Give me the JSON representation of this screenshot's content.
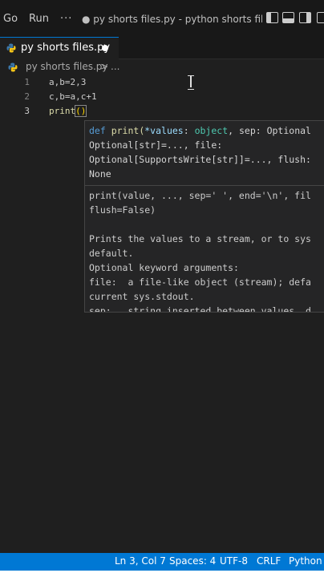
{
  "menu": {
    "go": "Go",
    "run": "Run",
    "more": "···"
  },
  "window_title": "● py shorts files.py - python shorts files - ...",
  "tab": {
    "label": "py shorts files.py",
    "modified": true
  },
  "breadcrumb": {
    "file": "py shorts files.py",
    "chevron": ">",
    "more": "..."
  },
  "editor": {
    "lines": [
      {
        "number": "1",
        "code": "a,b=2,3"
      },
      {
        "number": "2",
        "code": "c,b=a,c+1"
      },
      {
        "number": "3",
        "fn": "print",
        "paren": "()"
      }
    ]
  },
  "hover": {
    "signature": {
      "l1_def": "def",
      "l1_fn": " print(",
      "l1_param": "*values",
      "l1_colon": ": ",
      "l1_type": "object",
      "l1_rest": ", sep: Optional",
      "l2": "Optional[str]=..., file:",
      "l3": "Optional[SupportsWrite[str]]=..., flush:",
      "l4": "None"
    },
    "doc": [
      "print(value, ..., sep=' ', end='\\n', fil",
      "flush=False)",
      "",
      "Prints the values to a stream, or to sys",
      "default.",
      "Optional keyword arguments:",
      "file:  a file-like object (stream); defa",
      "current sys.stdout.",
      "sep:   string inserted between values, d"
    ]
  },
  "status": {
    "position": "Ln 3, Col 7",
    "spaces": "Spaces: 4",
    "encoding": "UTF-8",
    "eol": "CRLF",
    "language": "Python"
  },
  "colors": {
    "accent": "#0078d4",
    "python_icon": "#3c78aa"
  }
}
